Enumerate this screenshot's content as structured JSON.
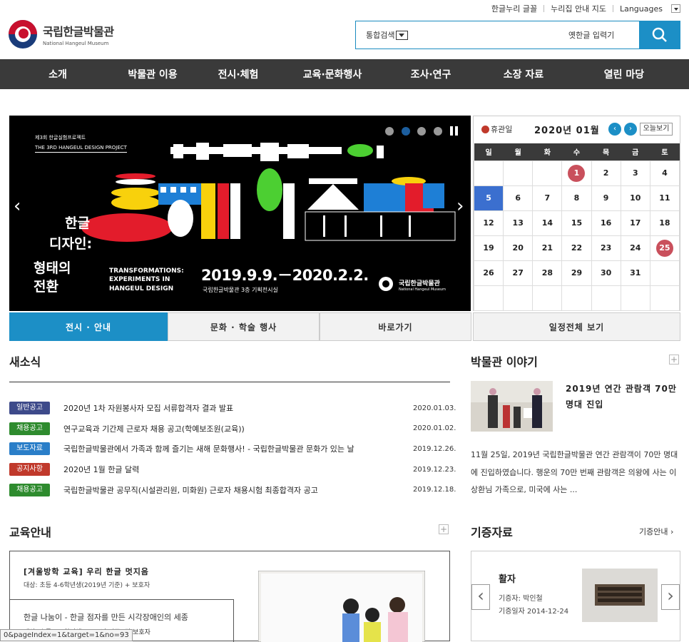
{
  "util": {
    "font": "한글누리 글꼴",
    "sitemap": "누리집 안내 지도",
    "languages": "Languages"
  },
  "logo": {
    "ko": "국립한글박물관",
    "en": "National Hangeul Museum"
  },
  "search": {
    "category": "통합검색",
    "old_hangul": "옛한글 입력기",
    "icon": "search-icon"
  },
  "gnb": [
    "소개",
    "박물관 이용",
    "전시·체험",
    "교육·문화행사",
    "조사·연구",
    "소장 자료",
    "열린 마당"
  ],
  "banner": {
    "project_ko": "제3회 한글실험프로젝트",
    "project_en": "THE 3RD HANGEUL DESIGN PROJECT",
    "title_1": "한글",
    "title_2": "디자인:",
    "title_3": "형태의",
    "title_4": "전환",
    "en_1": "TRANSFORMATIONS:",
    "en_2": "EXPERIMENTS IN",
    "en_3": "HANGEUL DESIGN",
    "dates": "2019.9.9.－2020.2.2.",
    "venue": "국립한글박물관 3층 기획전시실",
    "brand_ko": "국립한글박물관",
    "brand_en": "National Hangeul Museum",
    "prev": "‹",
    "next": "›"
  },
  "calendar": {
    "holiday_label": "휴관일",
    "year_month": "2020년 01월",
    "today_label": "오늘보기",
    "prev": "‹",
    "next": "›",
    "weekdays": [
      "일",
      "월",
      "화",
      "수",
      "목",
      "금",
      "토"
    ],
    "weeks": [
      [
        "",
        "",
        "",
        "1",
        "2",
        "3",
        "4"
      ],
      [
        "5",
        "6",
        "7",
        "8",
        "9",
        "10",
        "11"
      ],
      [
        "12",
        "13",
        "14",
        "15",
        "16",
        "17",
        "18"
      ],
      [
        "19",
        "20",
        "21",
        "22",
        "23",
        "24",
        "25"
      ],
      [
        "26",
        "27",
        "28",
        "29",
        "30",
        "31",
        ""
      ],
      [
        "",
        "",
        "",
        "",
        "",
        "",
        ""
      ]
    ],
    "selected_day": "5",
    "closed_days": [
      "1",
      "25"
    ]
  },
  "tabs": [
    "전시 · 안내",
    "문화 · 학술 행사",
    "바로가기",
    "일정전체 보기"
  ],
  "news": {
    "title": "새소식",
    "items": [
      {
        "badge": "일반공고",
        "color": "#3d4a8a",
        "title": "2020년 1차 자원봉사자 모집 서류합격자 결과 발표",
        "date": "2020.01.03."
      },
      {
        "badge": "채용공고",
        "color": "#2e8b2e",
        "title": "연구교육과 기간제 근로자 채용 공고(학예보조원(교육))",
        "date": "2020.01.02."
      },
      {
        "badge": "보도자료",
        "color": "#2a7ec8",
        "title": "국립한글박물관에서 가족과 함께 즐기는 새해 문화행사! - 국립한글박물관 문화가 있는 날",
        "date": "2019.12.26."
      },
      {
        "badge": "공지사항",
        "color": "#c0392b",
        "title": "2020년 1월 한글 달력",
        "date": "2019.12.23."
      },
      {
        "badge": "채용공고",
        "color": "#2e8b2e",
        "title": "국립한글박물관 공무직(시설관리원, 미화원) 근로자 채용시험 최종합격자 공고",
        "date": "2019.12.18."
      }
    ]
  },
  "story": {
    "title": "박물관 이야기",
    "headline": "2019년 연간 관람객 70만 명대 진입",
    "desc": "11월 25일, 2019년 국립한글박물관 연간 관람객이 70만 명대에 진입하였습니다. 행운의 70만 번째 관람객은 의왕에 사는 이상환님 가족으로, 미국에 사는 ..."
  },
  "edu": {
    "title": "교육안내",
    "item_title": "[겨울방학 교육] 우리 한글 멋지음",
    "item_target": "대상: 초등 4-6학년생(2019년 기준) + 보호자",
    "item2_title": "한글 나눔이 - 한글 점자를 만든 시각장애인의 세종",
    "item2_target": "대상: 초등 3-6학년생(2019년 기준) 및 보호자"
  },
  "donate": {
    "title": "기증자료",
    "more": "기증안내",
    "item": "활자",
    "donor": "기증자: 박인철",
    "date": "기증일자 2014-12-24"
  },
  "status": "0&pageIndex=1&target=1&no=93"
}
